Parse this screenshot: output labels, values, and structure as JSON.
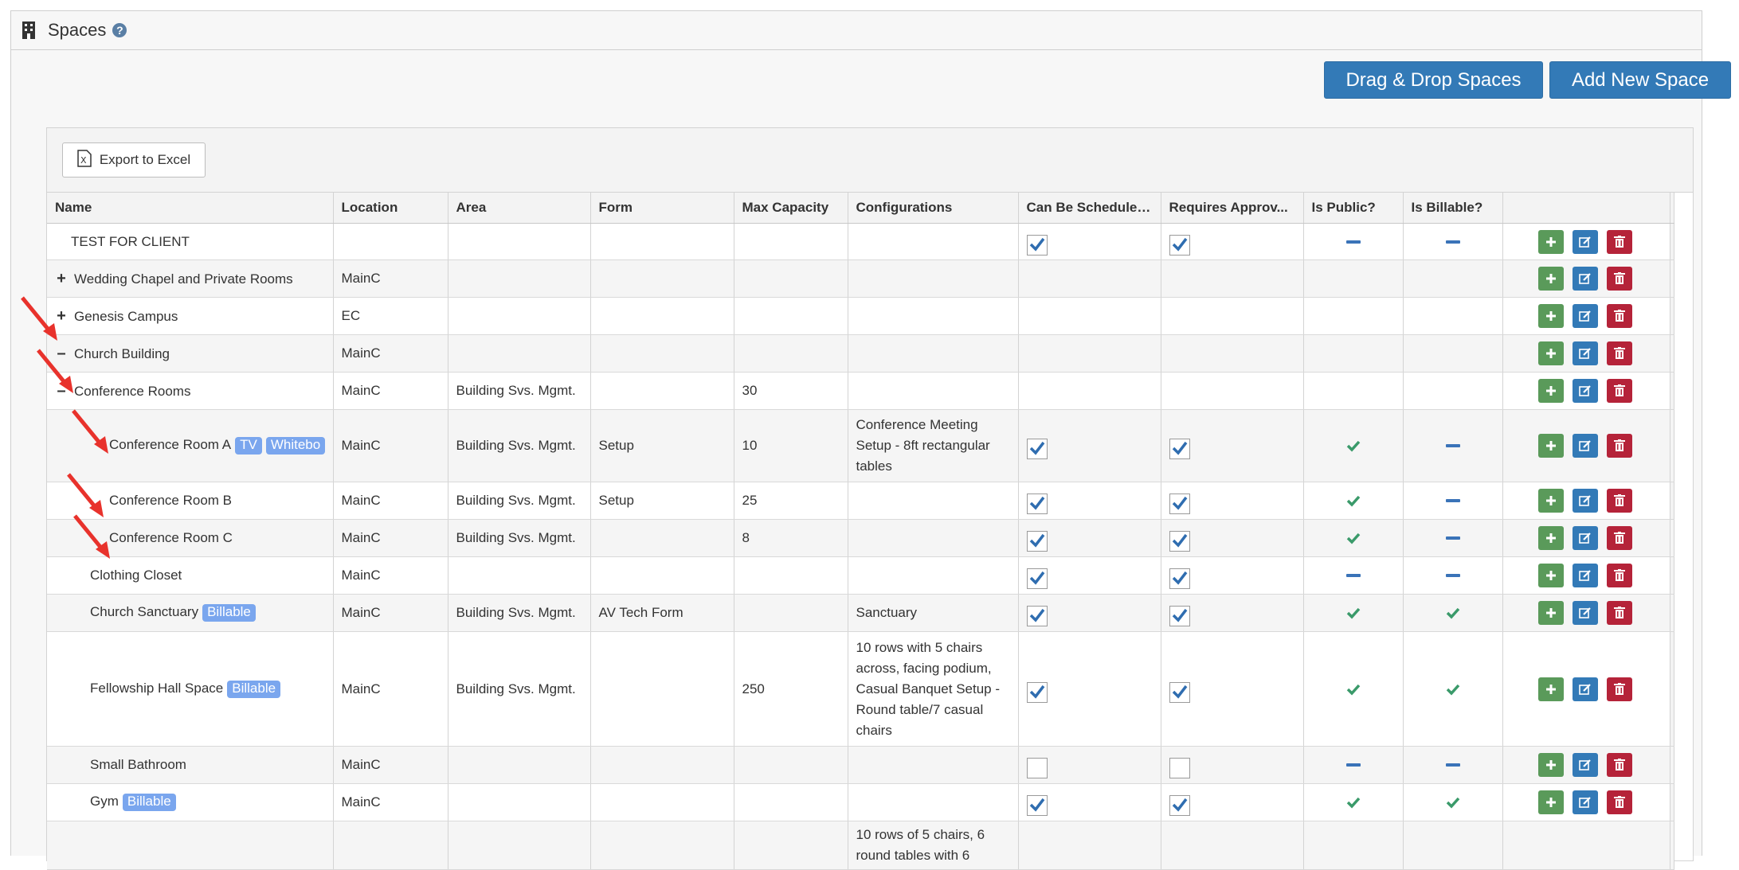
{
  "header": {
    "title": "Spaces",
    "help": "?"
  },
  "actions": {
    "drag_drop": "Drag & Drop Spaces",
    "add_new": "Add New Space"
  },
  "toolbar": {
    "export_label": "Export to Excel",
    "excel_glyph": "X"
  },
  "columns": [
    "Name",
    "Location",
    "Area",
    "Form",
    "Max Capacity",
    "Configurations",
    "Can Be Scheduled?",
    "Requires Approv...",
    "Is Public?",
    "Is Billable?"
  ],
  "rows": [
    {
      "indent": 1,
      "toggle": "",
      "name": "TEST FOR CLIENT",
      "badges": [],
      "location": "",
      "area": "",
      "form": "",
      "capacity": "",
      "config": "",
      "scheduled": "checked",
      "approval": "checked",
      "public": "dash",
      "billable": "dash"
    },
    {
      "indent": 0,
      "toggle": "+",
      "name": "Wedding Chapel and Private Rooms",
      "badges": [],
      "location": "MainC",
      "area": "",
      "form": "",
      "capacity": "",
      "config": "",
      "scheduled": "",
      "approval": "",
      "public": "",
      "billable": ""
    },
    {
      "indent": 0,
      "toggle": "+",
      "name": "Genesis Campus",
      "badges": [],
      "location": "EC",
      "area": "",
      "form": "",
      "capacity": "",
      "config": "",
      "scheduled": "",
      "approval": "",
      "public": "",
      "billable": ""
    },
    {
      "indent": 0,
      "toggle": "–",
      "name": "Church Building",
      "badges": [],
      "location": "MainC",
      "area": "",
      "form": "",
      "capacity": "",
      "config": "",
      "scheduled": "",
      "approval": "",
      "public": "",
      "billable": ""
    },
    {
      "indent": 1,
      "toggle": "–",
      "name": "Conference Rooms",
      "badges": [],
      "location": "MainC",
      "area": "Building Svs. Mgmt.",
      "form": "",
      "capacity": "30",
      "config": "",
      "scheduled": "",
      "approval": "",
      "public": "",
      "billable": ""
    },
    {
      "indent": 3,
      "toggle": "",
      "name": "Conference Room A",
      "badges": [
        "TV",
        "Whitebo"
      ],
      "location": "MainC",
      "area": "Building Svs. Mgmt.",
      "form": "Setup",
      "capacity": "10",
      "config": "Conference Meeting Setup - 8ft rectangular tables",
      "scheduled": "checked",
      "approval": "checked",
      "public": "check",
      "billable": "dash"
    },
    {
      "indent": 3,
      "toggle": "",
      "name": "Conference Room B",
      "badges": [],
      "location": "MainC",
      "area": "Building Svs. Mgmt.",
      "form": "Setup",
      "capacity": "25",
      "config": "",
      "scheduled": "checked",
      "approval": "checked",
      "public": "check",
      "billable": "dash"
    },
    {
      "indent": 3,
      "toggle": "",
      "name": "Conference Room C",
      "badges": [],
      "location": "MainC",
      "area": "Building Svs. Mgmt.",
      "form": "",
      "capacity": "8",
      "config": "",
      "scheduled": "checked",
      "approval": "checked",
      "public": "check",
      "billable": "dash"
    },
    {
      "indent": 2,
      "toggle": "",
      "name": "Clothing Closet",
      "badges": [],
      "location": "MainC",
      "area": "",
      "form": "",
      "capacity": "",
      "config": "",
      "scheduled": "checked",
      "approval": "checked",
      "public": "dash",
      "billable": "dash"
    },
    {
      "indent": 2,
      "toggle": "",
      "name": "Church Sanctuary",
      "badges": [
        "Billable"
      ],
      "location": "MainC",
      "area": "Building Svs. Mgmt.",
      "form": "AV Tech Form",
      "capacity": "",
      "config": "Sanctuary",
      "scheduled": "checked",
      "approval": "checked",
      "public": "check",
      "billable": "check"
    },
    {
      "indent": 2,
      "toggle": "",
      "name": "Fellowship Hall Space",
      "badges": [
        "Billable"
      ],
      "location": "MainC",
      "area": "Building Svs. Mgmt.",
      "form": "",
      "capacity": "250",
      "config": "10 rows with 5 chairs across, facing podium, Casual Banquet Setup - Round table/7 casual chairs",
      "scheduled": "checked",
      "approval": "checked",
      "public": "check",
      "billable": "check"
    },
    {
      "indent": 2,
      "toggle": "",
      "name": "Small Bathroom",
      "badges": [],
      "location": "MainC",
      "area": "",
      "form": "",
      "capacity": "",
      "config": "",
      "scheduled": "unchecked",
      "approval": "unchecked",
      "public": "dash",
      "billable": "dash"
    },
    {
      "indent": 2,
      "toggle": "",
      "name": "Gym",
      "badges": [
        "Billable"
      ],
      "location": "MainC",
      "area": "",
      "form": "",
      "capacity": "",
      "config": "",
      "scheduled": "checked",
      "approval": "checked",
      "public": "check",
      "billable": "check"
    },
    {
      "indent": 2,
      "toggle": "",
      "name": "",
      "badges": [],
      "location": "",
      "area": "",
      "form": "",
      "capacity": "",
      "config": "10 rows of 5 chairs, 6 round tables with 6",
      "scheduled": "",
      "approval": "",
      "public": "",
      "billable": ""
    }
  ],
  "colors": {
    "primary": "#337ab7",
    "add": "#5a9a5a",
    "delete": "#b52339",
    "badge": "#7aa6ee",
    "check": "#3a9a6a",
    "dash": "#3a73b8",
    "annotation_arrow": "#e8322c"
  }
}
